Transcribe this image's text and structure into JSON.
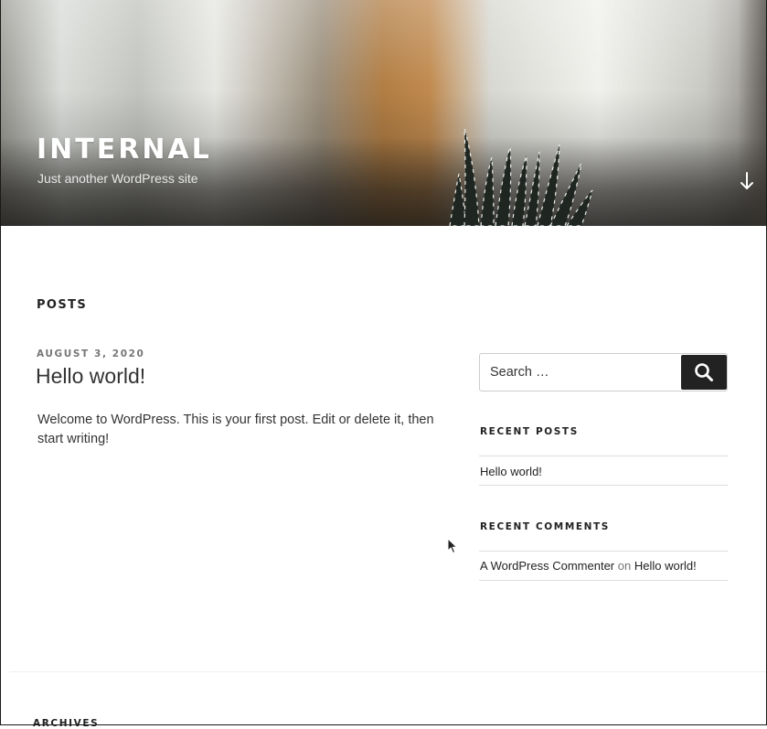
{
  "header": {
    "site_title": "INTERNAL",
    "site_description": "Just another WordPress site",
    "scroll_icon": "arrow-down-icon"
  },
  "main": {
    "page_title": "POSTS",
    "posts": [
      {
        "date": "AUGUST 3, 2020",
        "title": "Hello world!",
        "excerpt": "Welcome to WordPress. This is your first post. Edit or delete it, then start writing!"
      }
    ]
  },
  "sidebar": {
    "search": {
      "placeholder": "Search …",
      "button_icon": "search-icon"
    },
    "recent_posts": {
      "title": "RECENT POSTS",
      "items": [
        "Hello world!"
      ]
    },
    "recent_comments": {
      "title": "RECENT COMMENTS",
      "items": [
        {
          "author": "A WordPress Commenter",
          "on": "on",
          "post": "Hello world!"
        }
      ]
    }
  },
  "footer": {
    "archives_title": "ARCHIVES"
  },
  "colors": {
    "accent_dark": "#222222",
    "muted": "#767676",
    "rule": "#dddddd"
  }
}
